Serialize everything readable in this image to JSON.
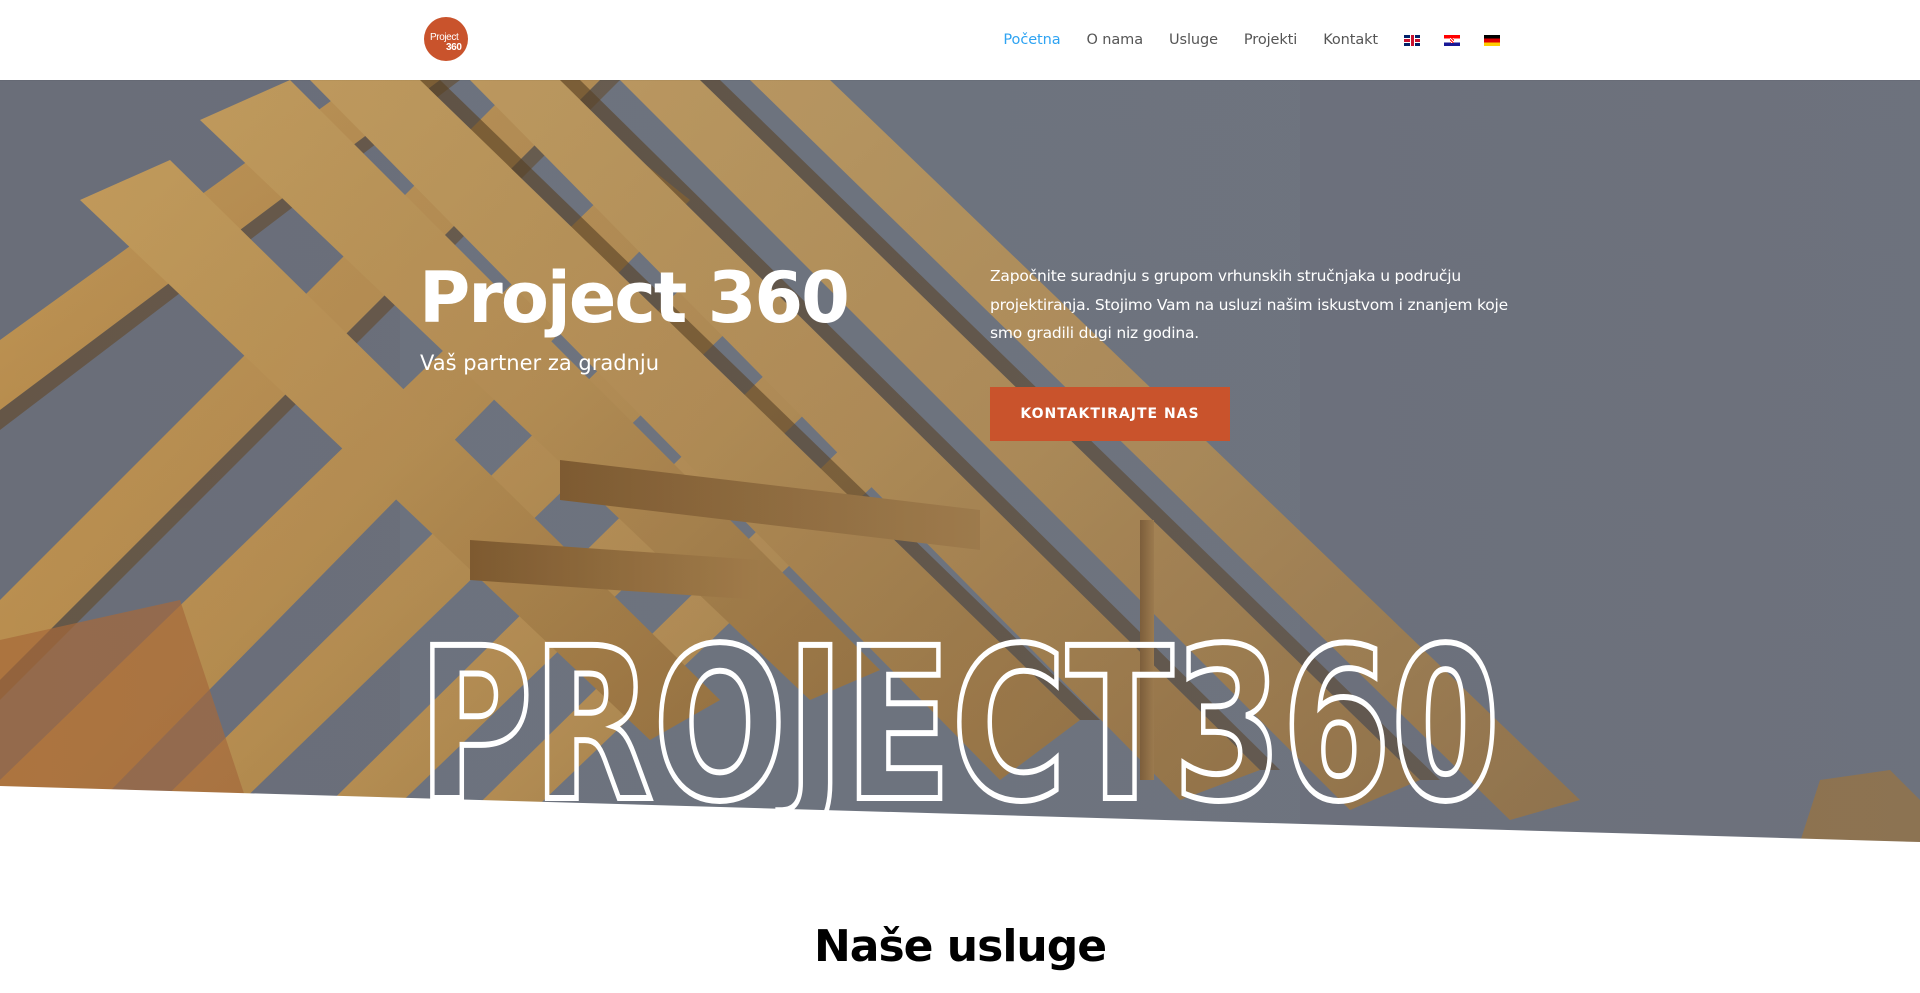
{
  "header": {
    "logo": {
      "word": "Project",
      "number": "360"
    },
    "nav": [
      {
        "label": "Početna",
        "active": true
      },
      {
        "label": "O nama",
        "active": false
      },
      {
        "label": "Usluge",
        "active": false
      },
      {
        "label": "Projekti",
        "active": false
      },
      {
        "label": "Kontakt",
        "active": false
      }
    ],
    "languages": [
      "flag-en-icon",
      "flag-hr-icon",
      "flag-de-icon"
    ]
  },
  "hero": {
    "title": "Project 360",
    "subtitle": "Vaš partner za gradnju",
    "description": "Započnite suradnju s grupom vrhunskih stručnjaka u području projektiranja. Stojimo Vam na usluzi našim iskustvom i znanjem koje smo gradili dugi niz godina.",
    "cta_label": "KONTAKTIRAJTE NAS",
    "outline_text": "PROJECT360"
  },
  "services": {
    "title": "Naše usluge"
  },
  "colors": {
    "accent": "#c9532c",
    "nav_active": "#2ea3f2",
    "nav_text": "#555555",
    "sky": "#737884",
    "wood": "#c89a55"
  }
}
